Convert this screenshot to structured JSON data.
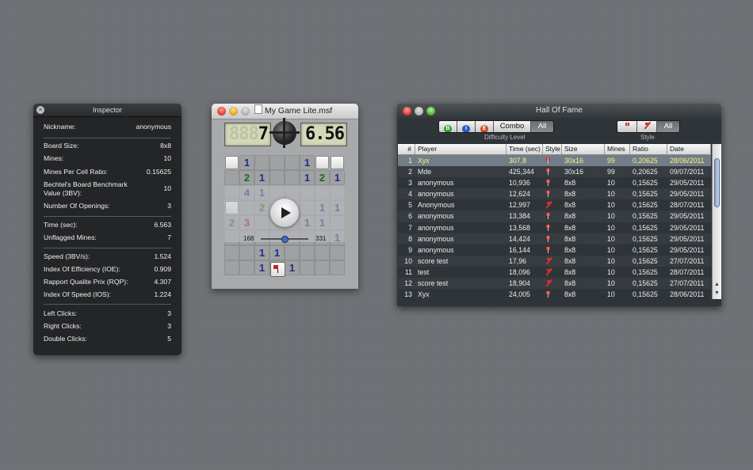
{
  "inspector": {
    "title": "Inspector",
    "rows": [
      {
        "label": "Nickname:",
        "value": "anonymous"
      },
      {
        "label": "Board Size:",
        "value": "8x8"
      },
      {
        "label": "Mines:",
        "value": "10"
      },
      {
        "label": "Mines Per Cell Ratio:",
        "value": "0.15625"
      },
      {
        "label": "Bechtel's Board Benchmark Value (3BV):",
        "value": "10"
      },
      {
        "label": "Number Of Openings:",
        "value": "3"
      },
      {
        "label": "Time (sec):",
        "value": "6.563"
      },
      {
        "label": "Unflagged Mines:",
        "value": "7"
      },
      {
        "label": "Speed (3BV/s):",
        "value": "1.524"
      },
      {
        "label": "Index Of Efficiency (IOE):",
        "value": "0.909"
      },
      {
        "label": "Rapport Qualite Prix (RQP):",
        "value": "4.307"
      },
      {
        "label": "Index Of Speed (IOS):",
        "value": "1.224"
      },
      {
        "label": "Left Clicks:",
        "value": "3"
      },
      {
        "label": "Right Clicks:",
        "value": "3"
      },
      {
        "label": "Double Clicks:",
        "value": "5"
      }
    ]
  },
  "game": {
    "title": "My Game Lite.msf",
    "mine_counter": "7",
    "mine_counter_ghost": "888",
    "timer": "6.56",
    "timer_ghost": "",
    "replay_start": "168",
    "replay_end": "331",
    "board": [
      [
        "c",
        "1",
        "",
        "",
        "",
        "1",
        "c",
        "c"
      ],
      [
        "",
        "2",
        "1",
        "",
        "",
        "1",
        "2",
        "1"
      ],
      [
        "",
        "4",
        "1",
        "",
        "",
        "",
        "",
        ""
      ],
      [
        "c",
        "",
        "2",
        "",
        "",
        "",
        "1",
        "1"
      ],
      [
        "2",
        "3",
        "",
        "",
        "",
        "1",
        "1",
        ""
      ],
      [
        "",
        "",
        "",
        "",
        "",
        "",
        "",
        "1"
      ],
      [
        "",
        "",
        "1",
        "1",
        "",
        "",
        "",
        ""
      ],
      [
        "",
        "",
        "1",
        "",
        "1",
        "",
        "",
        ""
      ]
    ]
  },
  "hall_of_fame": {
    "title": "Hall Of Fame",
    "difficulty_caption": "Difficulty Level",
    "style_caption": "Style",
    "difficulty_buttons": [
      "B",
      "I",
      "E",
      "Combo",
      "All"
    ],
    "style_buttons": [
      "All"
    ],
    "columns": [
      "#",
      "Player",
      "Time (sec)",
      "Style",
      "Size",
      "Mines",
      "Ratio",
      "Date"
    ],
    "rows": [
      {
        "n": "1",
        "player": "Xyx",
        "time": "307,8",
        "style": "flag",
        "size": "30x16",
        "mines": "99",
        "ratio": "0,20625",
        "date": "28/06/2011"
      },
      {
        "n": "2",
        "player": "Mde",
        "time": "425,344",
        "style": "flag",
        "size": "30x16",
        "mines": "99",
        "ratio": "0,20625",
        "date": "09/07/2011"
      },
      {
        "n": "3",
        "player": "anonymous",
        "time": "10,936",
        "style": "flag",
        "size": "8x8",
        "mines": "10",
        "ratio": "0,15625",
        "date": "29/05/2011"
      },
      {
        "n": "4",
        "player": "anonymous",
        "time": "12,624",
        "style": "flag",
        "size": "8x8",
        "mines": "10",
        "ratio": "0,15625",
        "date": "29/05/2011"
      },
      {
        "n": "5",
        "player": "Anonymous",
        "time": "12,997",
        "style": "cross",
        "size": "8x8",
        "mines": "10",
        "ratio": "0,15625",
        "date": "28/07/2011"
      },
      {
        "n": "6",
        "player": "anonymous",
        "time": "13,384",
        "style": "flag",
        "size": "8x8",
        "mines": "10",
        "ratio": "0,15625",
        "date": "29/05/2011"
      },
      {
        "n": "7",
        "player": "anonymous",
        "time": "13,568",
        "style": "flag",
        "size": "8x8",
        "mines": "10",
        "ratio": "0,15625",
        "date": "29/05/2011"
      },
      {
        "n": "8",
        "player": "anonymous",
        "time": "14,424",
        "style": "flag",
        "size": "8x8",
        "mines": "10",
        "ratio": "0,15625",
        "date": "29/05/2011"
      },
      {
        "n": "9",
        "player": "anonymous",
        "time": "16,144",
        "style": "flag",
        "size": "8x8",
        "mines": "10",
        "ratio": "0,15625",
        "date": "29/05/2011"
      },
      {
        "n": "10",
        "player": "score test",
        "time": "17,96",
        "style": "cross",
        "size": "8x8",
        "mines": "10",
        "ratio": "0,15625",
        "date": "27/07/2011"
      },
      {
        "n": "11",
        "player": "test",
        "time": "18,096",
        "style": "cross",
        "size": "8x8",
        "mines": "10",
        "ratio": "0,15625",
        "date": "28/07/2011"
      },
      {
        "n": "12",
        "player": "score test",
        "time": "18,904",
        "style": "cross",
        "size": "8x8",
        "mines": "10",
        "ratio": "0,15625",
        "date": "27/07/2011"
      },
      {
        "n": "13",
        "player": "Xyx",
        "time": "24,005",
        "style": "flag",
        "size": "8x8",
        "mines": "10",
        "ratio": "0,15625",
        "date": "28/06/2011"
      }
    ]
  },
  "colors": {
    "selected_row_text": "#fff27a",
    "beginner": "#2f9e2f",
    "intermediate": "#2a55c9",
    "expert": "#c84a1e"
  }
}
